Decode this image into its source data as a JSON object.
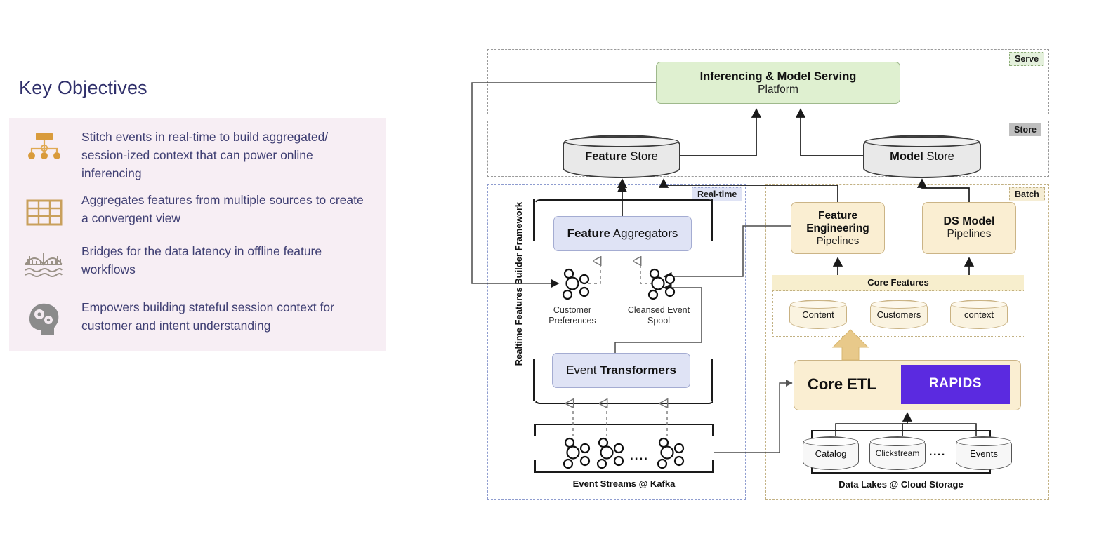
{
  "left": {
    "title": "Key Objectives",
    "objectives": [
      {
        "icon": "hierarchy-icon",
        "text": "Stitch events in real-time to build aggregated/ session-ized context that can power online inferencing"
      },
      {
        "icon": "table-grid-icon",
        "text": "Aggregates features from multiple sources to create a convergent view"
      },
      {
        "icon": "bridge-icon",
        "text": "Bridges for the data latency in offline feature workflows"
      },
      {
        "icon": "head-gears-icon",
        "text": "Empowers building stateful session context for customer and intent understanding"
      }
    ]
  },
  "diagram": {
    "layers": {
      "serve": "Serve",
      "store": "Store",
      "realtime": "Real-time",
      "batch": "Batch"
    },
    "serve": {
      "platform": {
        "line1": "Inferencing & Model Serving",
        "line2": "Platform"
      }
    },
    "store": {
      "feature_store": {
        "bold": "Feature",
        "rest": " Store"
      },
      "model_store": {
        "bold": "Model",
        "rest": " Store"
      }
    },
    "realtime": {
      "framework_label": "Realtime Features Builder Framework",
      "feature_aggregators": {
        "bold": "Feature",
        "rest": " Aggregators"
      },
      "event_transformers": {
        "pre": "Event ",
        "bold": "Transformers"
      },
      "nodes": [
        {
          "name": "Customer Preferences"
        },
        {
          "name": "Cleansed Event Spool"
        }
      ],
      "streams_caption": "Event Streams @ Kafka",
      "streams_ellipsis": "...."
    },
    "batch": {
      "feature_engineering": {
        "line1": "Feature",
        "line2": "Engineering",
        "line3": "Pipelines"
      },
      "ds_model": {
        "line1": "DS Model",
        "line2": "Pipelines"
      },
      "core_features_label": "Core Features",
      "core_feature_stores": [
        "Content",
        "Customers",
        "context"
      ],
      "core_etl": "Core ETL",
      "rapids": "RAPIDS",
      "lakes_caption": "Data Lakes @ Cloud Storage",
      "lakes": [
        "Catalog",
        "Clickstream",
        "Events"
      ],
      "lakes_ellipsis": "...."
    }
  },
  "colors": {
    "title": "#30306b",
    "card_bg": "#f7eef4",
    "body_text": "#3f3f73",
    "serve_green": "#dff0d0",
    "store_gray": "#eeeeee",
    "realtime_blue": "#dfe3f5",
    "batch_tan": "#f5e6c8",
    "rapids_purple": "#5b2ae0",
    "icon_orange": "#d99b3c",
    "icon_gray": "#8b8b8b"
  }
}
